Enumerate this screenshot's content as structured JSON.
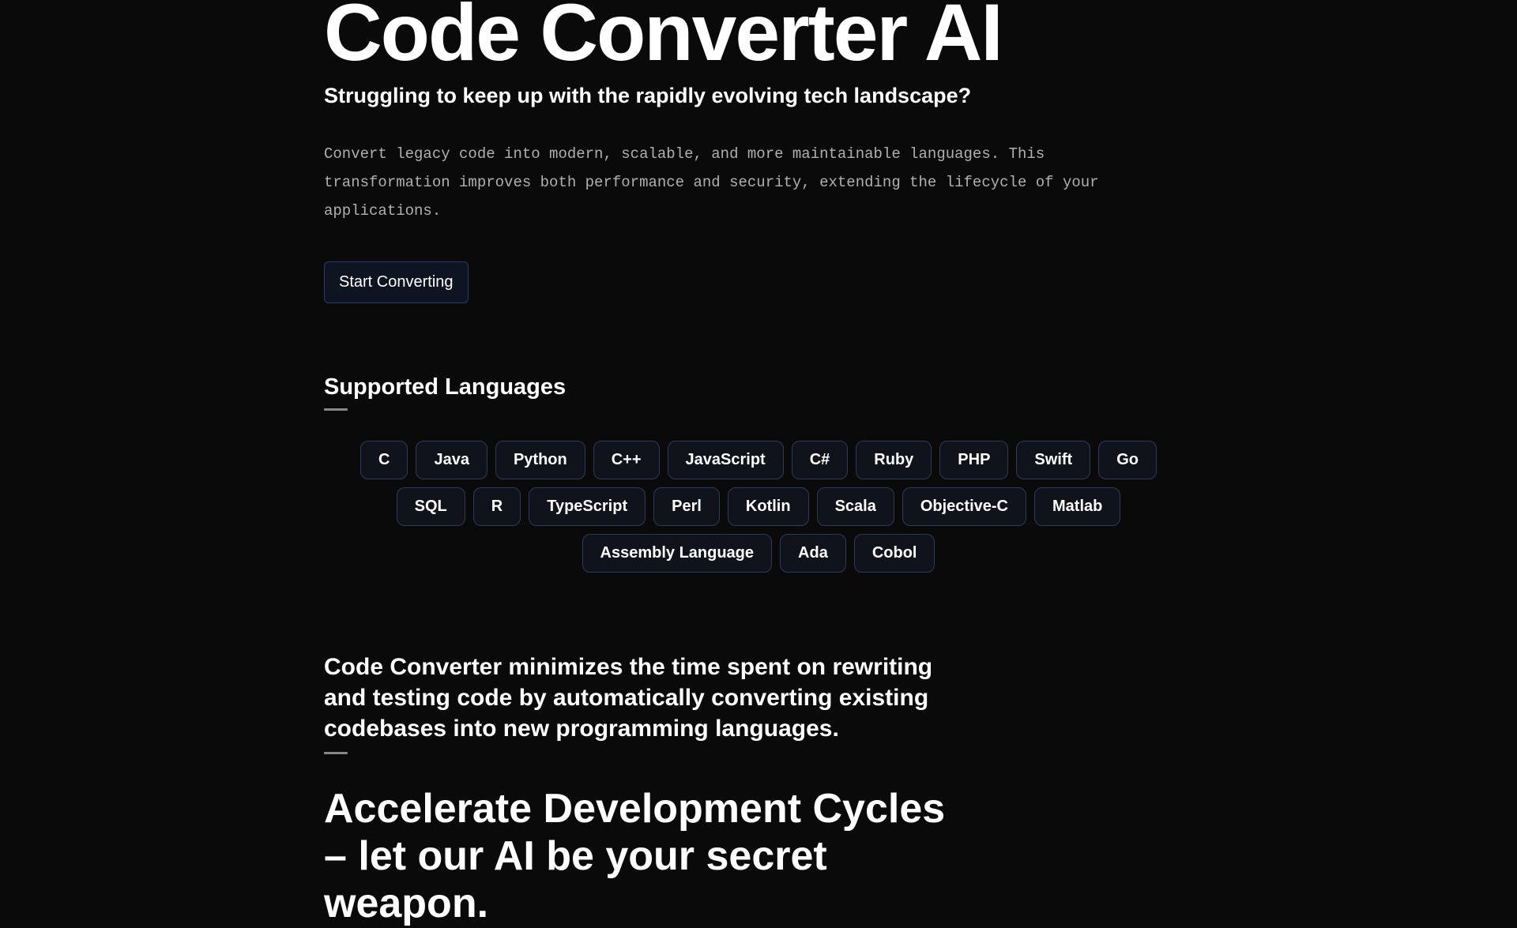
{
  "hero": {
    "title": "Code Converter AI",
    "subtitle": "Struggling to keep up with the rapidly evolving tech landscape?",
    "description": "Convert legacy code into modern, scalable, and more maintainable languages. This transformation improves both performance and security, extending the lifecycle of your applications.",
    "cta": "Start Converting"
  },
  "languages": {
    "heading": "Supported Languages",
    "items": [
      "C",
      "Java",
      "Python",
      "C++",
      "JavaScript",
      "C#",
      "Ruby",
      "PHP",
      "Swift",
      "Go",
      "SQL",
      "R",
      "TypeScript",
      "Perl",
      "Kotlin",
      "Scala",
      "Objective-C",
      "Matlab",
      "Assembly Language",
      "Ada",
      "Cobol"
    ]
  },
  "minimize": {
    "text": "Code Converter minimizes the time spent on rewriting and testing code by automatically converting existing codebases into new programming languages."
  },
  "accelerate": {
    "text": "Accelerate Development Cycles – let our AI be your secret weapon."
  }
}
